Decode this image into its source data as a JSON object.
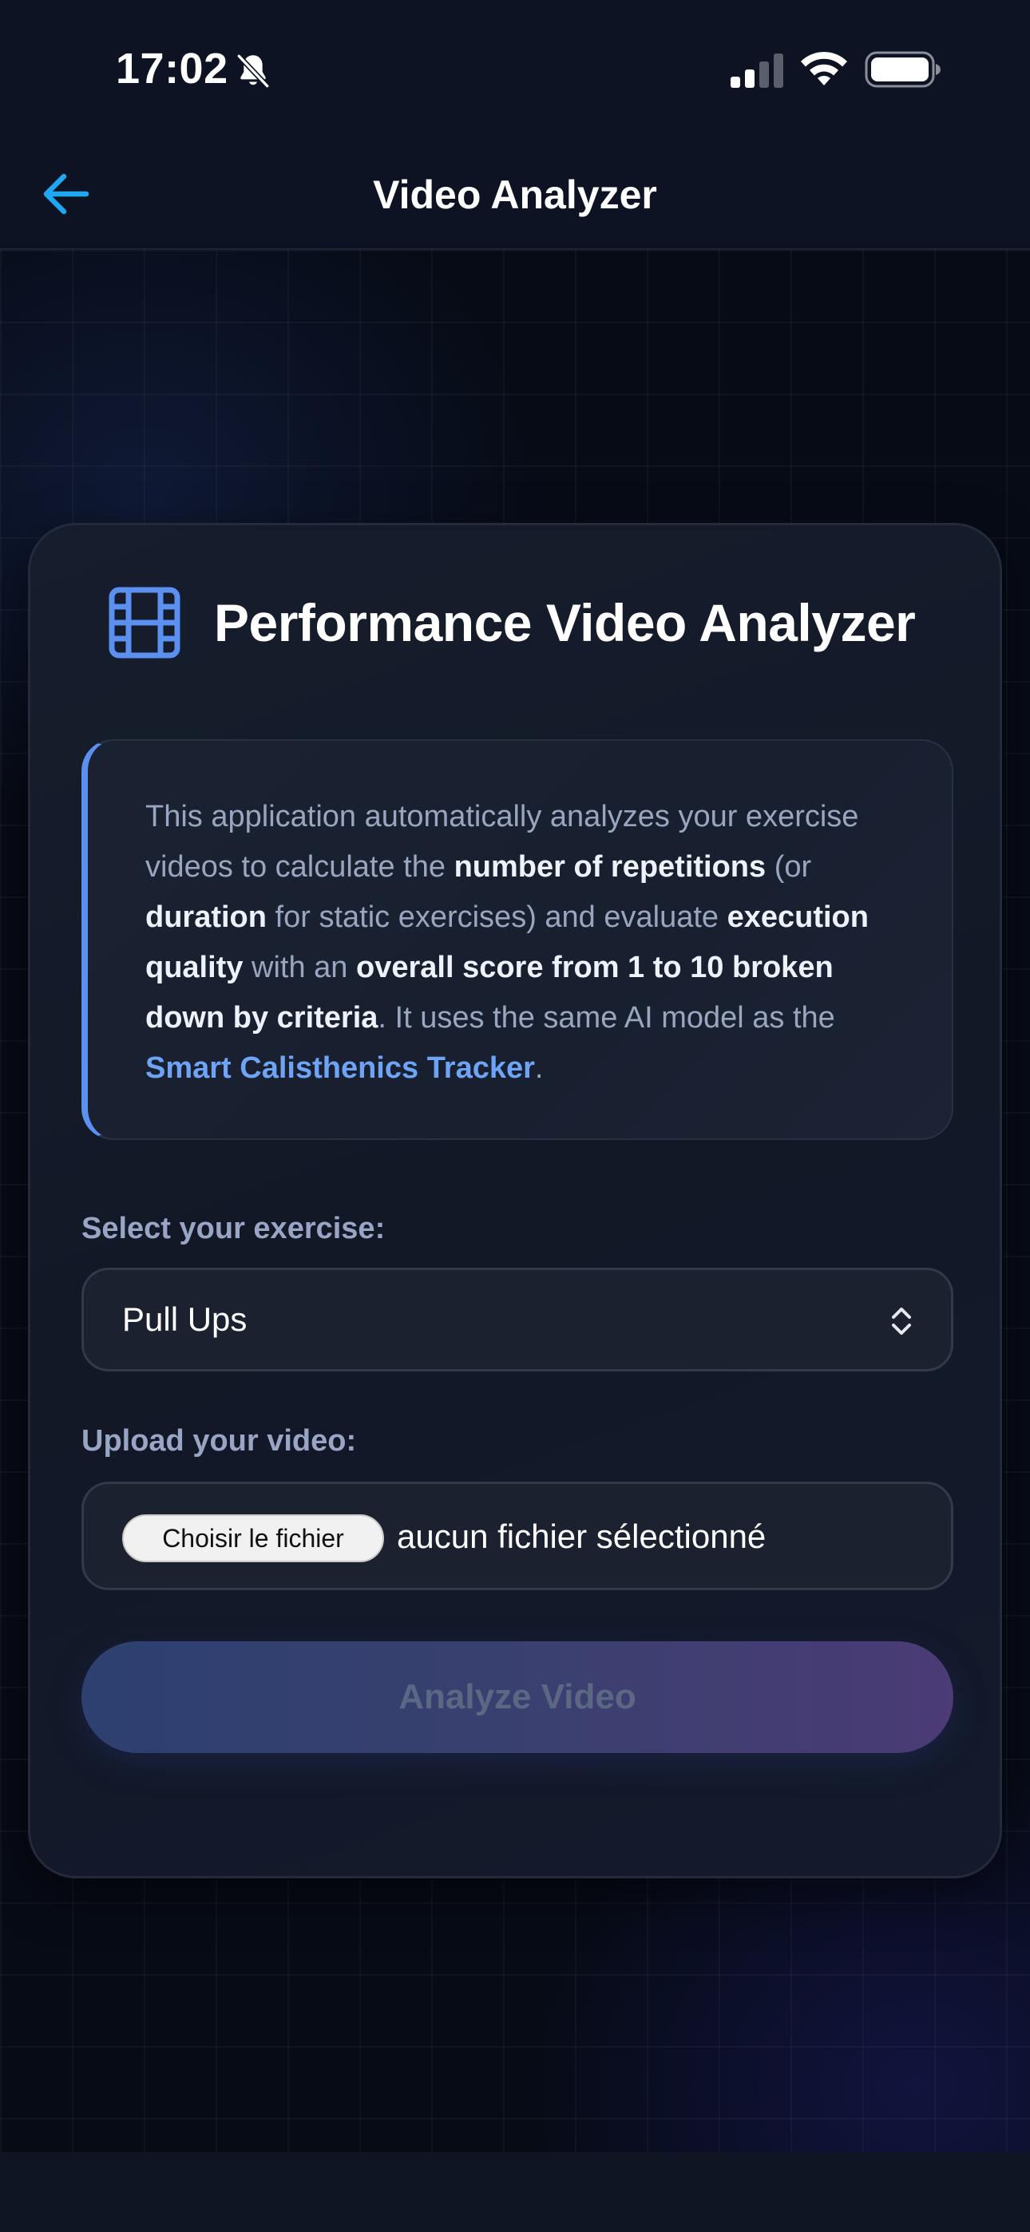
{
  "status_bar": {
    "time": "17:02",
    "icons": [
      "bell-slash-icon",
      "cellular-signal-icon",
      "wifi-icon",
      "battery-icon"
    ]
  },
  "nav": {
    "back_icon": "arrow-left-icon",
    "title": "Video Analyzer"
  },
  "card": {
    "icon": "film-icon",
    "title": "Performance Video Analyzer",
    "description": {
      "t1": "This application automatically analyzes your exercise videos to calculate the ",
      "b1": "number of repetitions",
      "t2": " (or ",
      "b2": "duration",
      "t3": " for static exercises) and evaluate ",
      "b3": "execution quality",
      "t4": " with an ",
      "b4": "overall score from 1 to 10 broken down by criteria",
      "t5": ". It uses the same AI model as the ",
      "link": "Smart Calisthenics Tracker",
      "t6": "."
    },
    "exercise_label": "Select your exercise:",
    "exercise_value": "Pull Ups",
    "upload_label": "Upload your video:",
    "file_button": "Choisir le fichier",
    "file_status": "aucun fichier sélectionné",
    "analyze_button": "Analyze Video"
  },
  "colors": {
    "accent": "#5b8ff0",
    "link": "#6ea3f5",
    "back_arrow": "#1ea7f2"
  }
}
